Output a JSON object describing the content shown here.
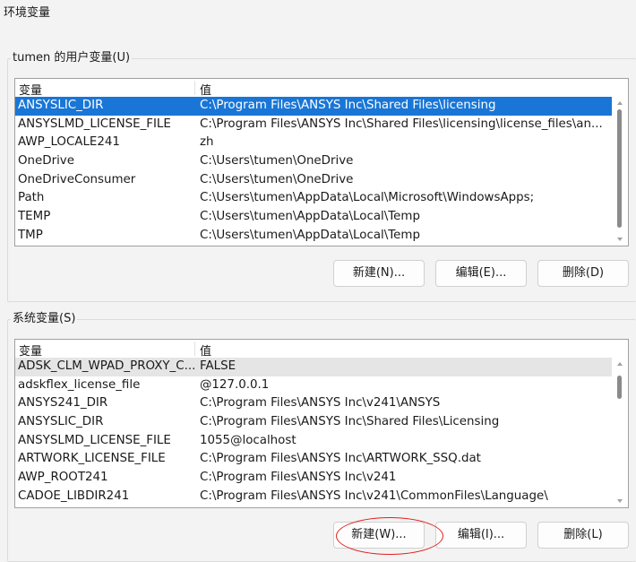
{
  "window": {
    "title": "环境变量"
  },
  "user_vars": {
    "group_label": "tumen 的用户变量(U)",
    "columns": [
      "变量",
      "值"
    ],
    "rows": [
      {
        "name": "ANSYSLIC_DIR",
        "value": "C:\\Program Files\\ANSYS Inc\\Shared Files\\licensing"
      },
      {
        "name": "ANSYSLMD_LICENSE_FILE",
        "value": "C:\\Program Files\\ANSYS Inc\\Shared Files\\licensing\\license_files\\an..."
      },
      {
        "name": "AWP_LOCALE241",
        "value": "zh"
      },
      {
        "name": "OneDrive",
        "value": "C:\\Users\\tumen\\OneDrive"
      },
      {
        "name": "OneDriveConsumer",
        "value": "C:\\Users\\tumen\\OneDrive"
      },
      {
        "name": "Path",
        "value": "C:\\Users\\tumen\\AppData\\Local\\Microsoft\\WindowsApps;"
      },
      {
        "name": "TEMP",
        "value": "C:\\Users\\tumen\\AppData\\Local\\Temp"
      },
      {
        "name": "TMP",
        "value": "C:\\Users\\tumen\\AppData\\Local\\Temp"
      }
    ],
    "selected_index": 0,
    "buttons": {
      "new": "新建(N)...",
      "edit": "编辑(E)...",
      "delete": "删除(D)"
    }
  },
  "system_vars": {
    "group_label": "系统变量(S)",
    "columns": [
      "变量",
      "值"
    ],
    "rows": [
      {
        "name": "ADSK_CLM_WPAD_PROXY_C...",
        "value": "FALSE"
      },
      {
        "name": "adskflex_license_file",
        "value": "@127.0.0.1"
      },
      {
        "name": "ANSYS241_DIR",
        "value": "C:\\Program Files\\ANSYS Inc\\v241\\ANSYS"
      },
      {
        "name": "ANSYSLIC_DIR",
        "value": "C:\\Program Files\\ANSYS Inc\\Shared Files\\Licensing"
      },
      {
        "name": "ANSYSLMD_LICENSE_FILE",
        "value": "1055@localhost"
      },
      {
        "name": "ARTWORK_LICENSE_FILE",
        "value": "C:\\Program Files\\ANSYS Inc\\ARTWORK_SSQ.dat"
      },
      {
        "name": "AWP_ROOT241",
        "value": "C:\\Program Files\\ANSYS Inc\\v241"
      },
      {
        "name": "CADOE_LIBDIR241",
        "value": "C:\\Program Files\\ANSYS Inc\\v241\\CommonFiles\\Language\\"
      }
    ],
    "hover_index": 0,
    "buttons": {
      "new": "新建(W)...",
      "edit": "编辑(I)...",
      "delete": "删除(L)"
    }
  },
  "annotation": {
    "color": "#e31e1e",
    "target": "system-new-button"
  },
  "colors": {
    "selection": "#1976d6",
    "window_bg": "#f3f3f3"
  }
}
